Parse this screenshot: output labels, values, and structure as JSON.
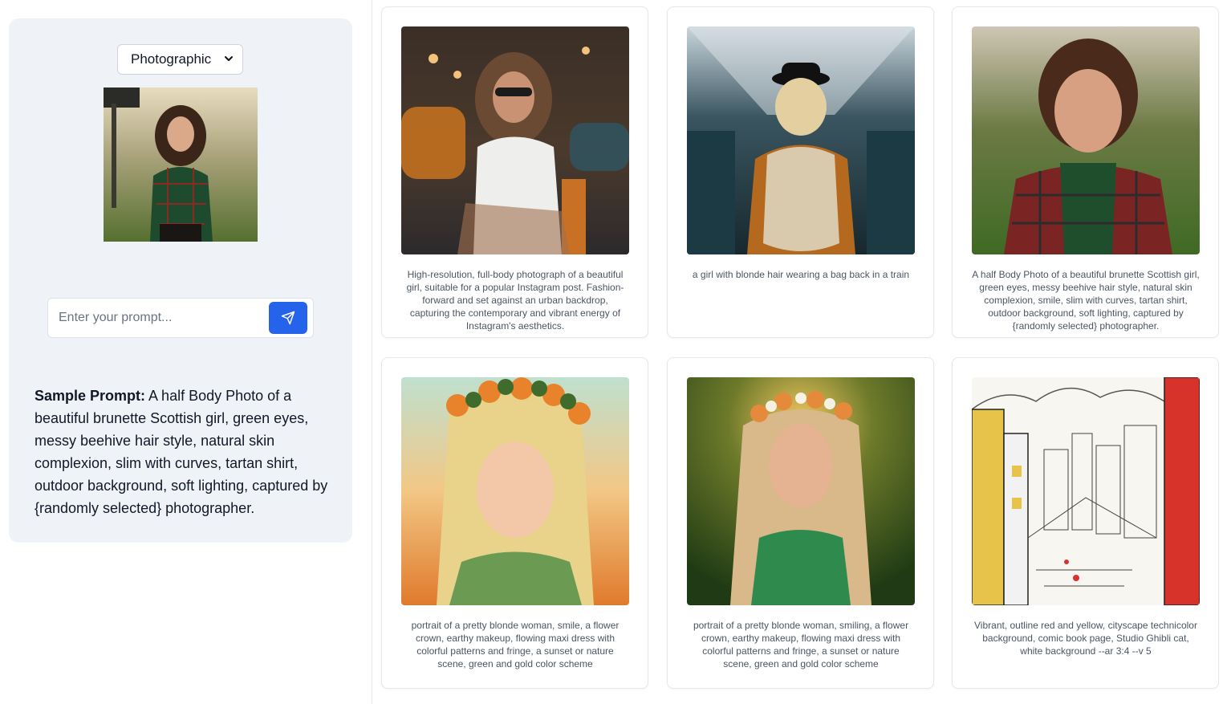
{
  "style_select": {
    "value": "Photographic",
    "icon": "chevron-down-icon"
  },
  "prompt": {
    "placeholder": "Enter your prompt...",
    "value": "",
    "send_icon": "send-icon"
  },
  "sample": {
    "label": "Sample Prompt:",
    "text": "A half Body Photo of a beautiful brunette Scottish girl, green eyes, messy beehive hair style, natural skin complexion, slim with curves, tartan shirt, outdoor background, soft lighting, captured by {randomly selected} photographer."
  },
  "colors": {
    "accent": "#2563eb",
    "panel": "#eff2f7",
    "border": "#e5e7eb"
  },
  "gallery": [
    {
      "caption": "High-resolution, full-body photograph of a beautiful girl, suitable for a popular Instagram post. Fashion-forward and set against an urban backdrop, capturing the contemporary and vibrant energy of Instagram's aesthetics."
    },
    {
      "caption": "a girl with blonde hair wearing a bag back in a train"
    },
    {
      "caption": "A half Body Photo of a beautiful brunette Scottish girl, green eyes, messy beehive hair style, natural skin complexion, smile, slim with curves, tartan shirt, outdoor background, soft lighting, captured by {randomly selected} photographer."
    },
    {
      "caption": "portrait of a pretty blonde woman, smile, a flower crown, earthy makeup, flowing maxi dress with colorful patterns and fringe, a sunset or nature scene, green and gold color scheme"
    },
    {
      "caption": "portrait of a pretty blonde woman, smiling, a flower crown, earthy makeup, flowing maxi dress with colorful patterns and fringe, a sunset or nature scene, green and gold color scheme"
    },
    {
      "caption": "Vibrant, outline red and yellow, cityscape technicolor background, comic book page, Studio Ghibli cat, white background --ar 3:4 --v 5"
    }
  ]
}
